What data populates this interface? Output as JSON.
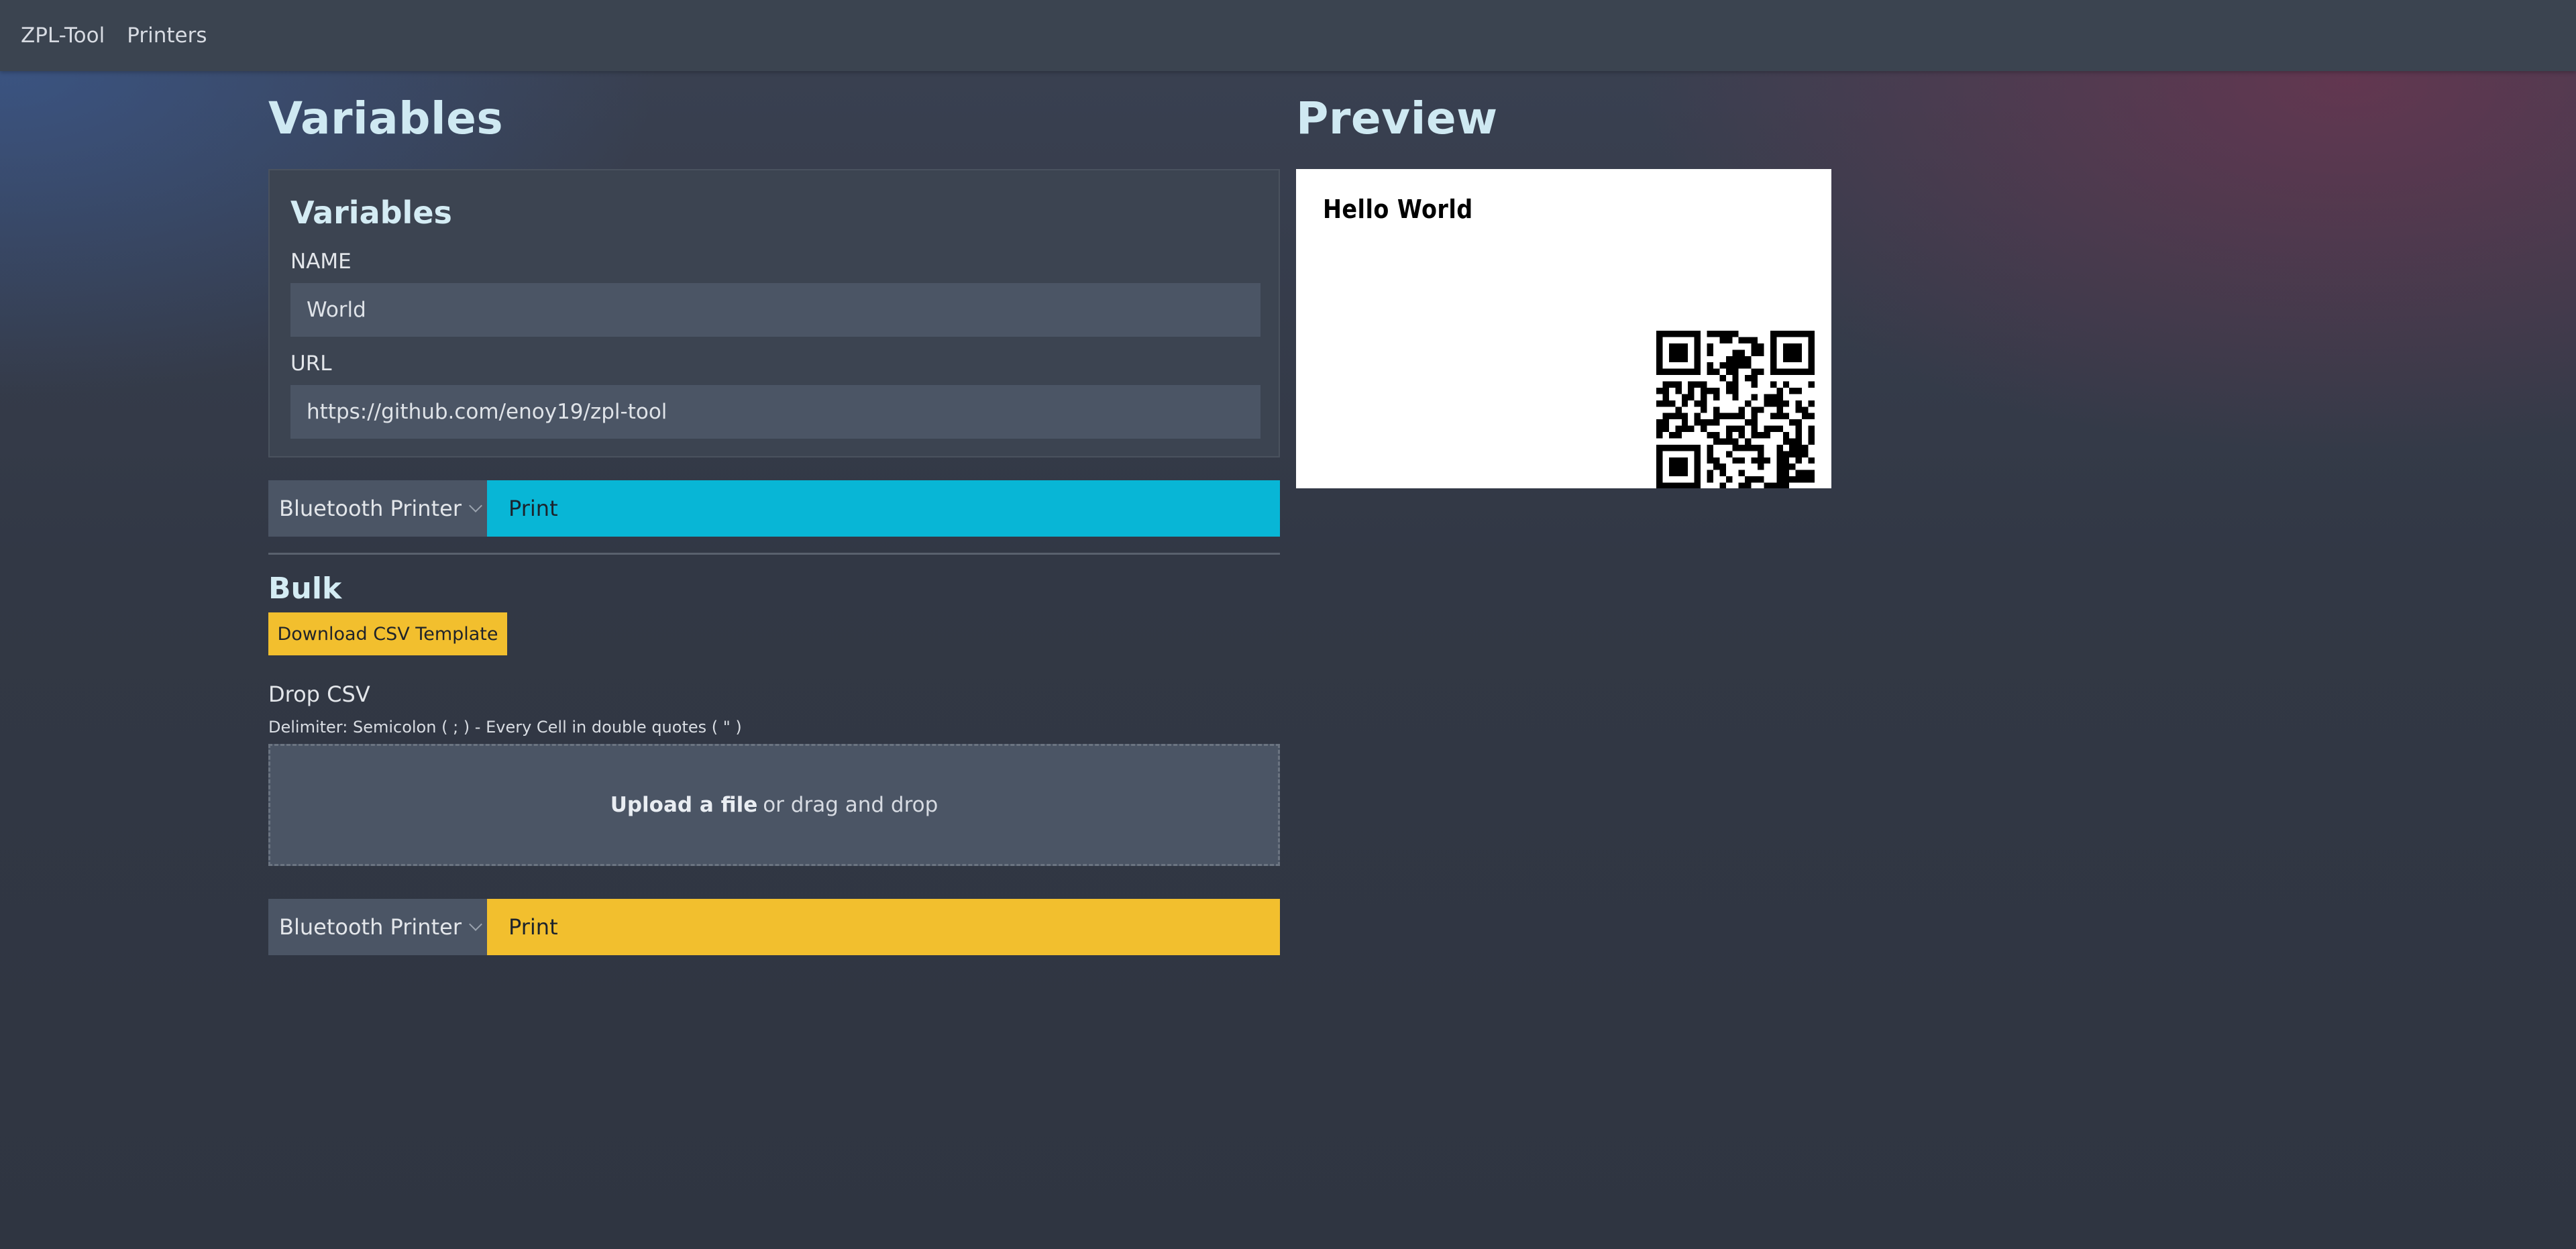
{
  "navbar": {
    "brand": "ZPL-Tool",
    "printers": "Printers"
  },
  "variables": {
    "heading": "Variables",
    "panel_title": "Variables",
    "fields": [
      {
        "label": "NAME",
        "value": "World"
      },
      {
        "label": "URL",
        "value": "https://github.com/enoy19/zpl-tool"
      }
    ]
  },
  "single_print": {
    "printer": "Bluetooth Printer",
    "button": "Print",
    "color": "#08b6d6"
  },
  "bulk": {
    "title": "Bulk",
    "csv_button": "Download CSV Template",
    "drop_label": "Drop CSV",
    "delimiter_hint": "Delimiter: Semicolon ( ; ) - Every Cell in double quotes ( \" )",
    "upload_link": "Upload a file",
    "upload_rest": "or drag and drop",
    "printer": "Bluetooth Printer",
    "button": "Print",
    "color": "#f2bf2e"
  },
  "preview": {
    "heading": "Preview",
    "label_text": "Hello World"
  }
}
